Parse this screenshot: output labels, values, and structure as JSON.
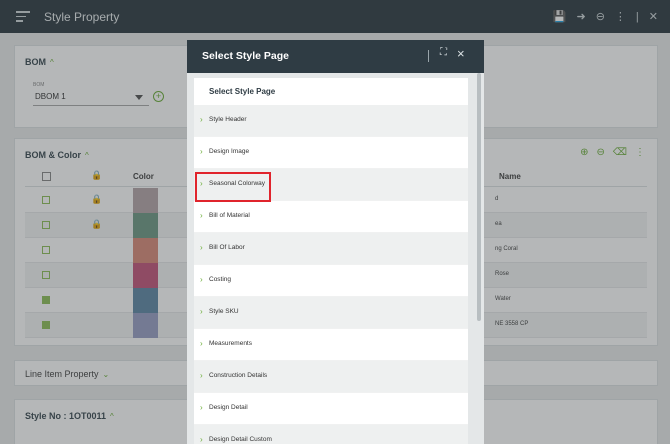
{
  "app": {
    "title": "Style Property"
  },
  "bom": {
    "header": "BOM",
    "field_label": "BOM",
    "selected": "DBOM 1"
  },
  "bom_color": {
    "header": "BOM & Color",
    "columns": [
      "Color",
      "Name"
    ],
    "rows": [
      {
        "checked": false,
        "locked": true,
        "swatch": "#b6a6aa",
        "name": "d"
      },
      {
        "checked": false,
        "locked": true,
        "swatch": "#6f9a86",
        "name": "ea"
      },
      {
        "checked": false,
        "locked": false,
        "swatch": "#d98b7a",
        "name": "ng Coral"
      },
      {
        "checked": false,
        "locked": false,
        "swatch": "#c4577c",
        "name": "Rose"
      },
      {
        "checked": true,
        "locked": false,
        "swatch": "#6088a6",
        "name": "Water"
      },
      {
        "checked": true,
        "locked": false,
        "swatch": "#9aa0c6",
        "name": "NE 3558 CP"
      }
    ]
  },
  "line_item": {
    "header": "Line Item Property"
  },
  "style_no": {
    "header": "Style No : 1OT0011"
  },
  "modal": {
    "title": "Select Style Page",
    "subtitle": "Select Style Page",
    "items": [
      "Style Header",
      "Design Image",
      "Seasonal Colorway",
      "Bill of Material",
      "Bill Of Labor",
      "Costing",
      "Style SKU",
      "Measurements",
      "Construction Details",
      "Design Detail",
      "Design Detail Custom"
    ],
    "highlighted_index": 2
  },
  "colors": {
    "accent": "#6dae3a",
    "header_bg": "#2f3c44",
    "highlight": "#e0242c"
  }
}
